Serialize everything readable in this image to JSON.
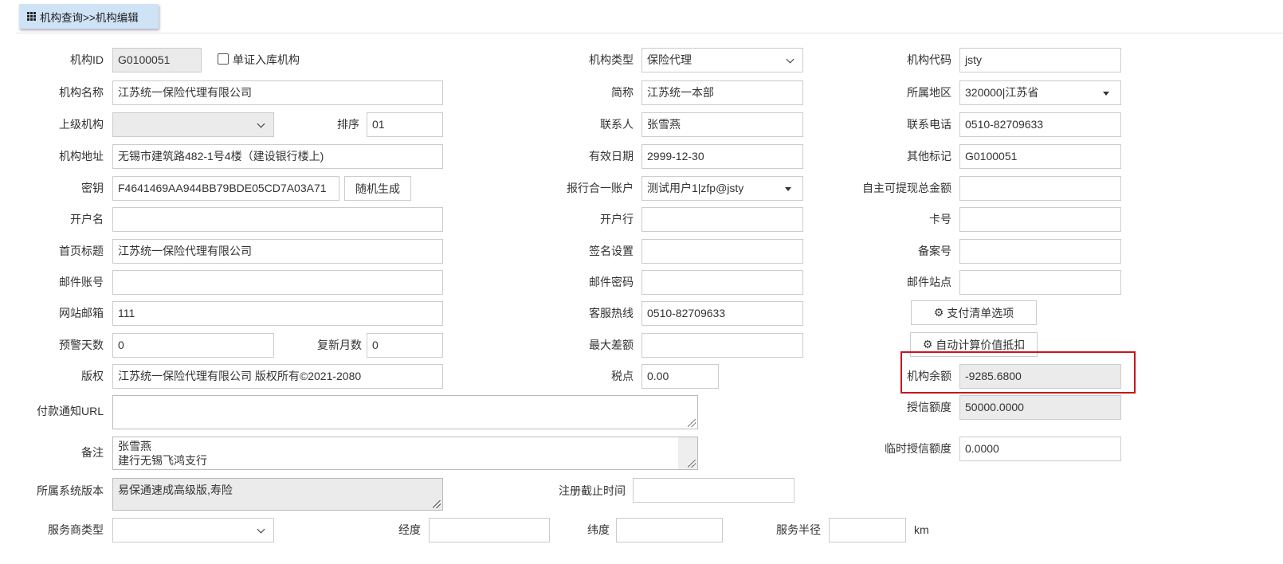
{
  "breadcrumb": "机构查询>>机构编辑",
  "col1": {
    "id_label": "机构ID",
    "id_value": "G0100051",
    "single_check_label": "单证入库机构",
    "name_label": "机构名称",
    "name_value": "江苏统一保险代理有限公司",
    "parent_label": "上级机构",
    "parent_value": "",
    "order_label": "排序",
    "order_value": "01",
    "address_label": "机构地址",
    "address_value": "无锡市建筑路482-1号4楼（建设银行楼上)",
    "key_label": "密钥",
    "key_value": "F4641469AA944BB79BDE05CD7A03A71",
    "random_button": "随机生成",
    "account_name_label": "开户名",
    "account_name_value": "",
    "home_title_label": "首页标题",
    "home_title_value": "江苏统一保险代理有限公司",
    "mail_account_label": "邮件账号",
    "mail_account_value": "",
    "site_mail_label": "网站邮箱",
    "site_mail_value": "111",
    "warn_days_label": "预警天数",
    "warn_days_value": "0",
    "renew_months_label": "复新月数",
    "renew_months_value": "0",
    "copyright_label": "版权",
    "copyright_value": "江苏统一保险代理有限公司 版权所有©2021-2080",
    "pay_url_label": "付款通知URL",
    "pay_url_value": "",
    "remark_label": "备注",
    "remark_line1": "张雪燕",
    "remark_line2": "建行无锡飞鸿支行",
    "sys_version_label": "所属系统版本",
    "sys_version_value": "易保通速成高级版,寿险",
    "reg_deadline_label": "注册截止时间",
    "reg_deadline_value": "",
    "provider_type_label": "服务商类型",
    "provider_type_value": "",
    "longitude_label": "经度",
    "longitude_value": "",
    "latitude_label": "纬度",
    "latitude_value": "",
    "radius_label": "服务半径",
    "radius_value": "",
    "radius_unit": "km"
  },
  "col2": {
    "type_label": "机构类型",
    "type_value": "保险代理",
    "short_label": "简称",
    "short_value": "江苏统一本部",
    "contact_label": "联系人",
    "contact_value": "张雪燕",
    "valid_label": "有效日期",
    "valid_value": "2999-12-30",
    "report_account_label": "报行合一账户",
    "report_account_value": "测试用户1|zfp@jsty",
    "bank_label": "开户行",
    "bank_value": "",
    "sign_label": "签名设置",
    "sign_value": "",
    "mail_pwd_label": "邮件密码",
    "mail_pwd_value": "",
    "hotline_label": "客服热线",
    "hotline_value": "0510-82709633",
    "max_diff_label": "最大差额",
    "max_diff_value": "",
    "tax_label": "税点",
    "tax_value": "0.00"
  },
  "col3": {
    "code_label": "机构代码",
    "code_value": "jsty",
    "region_label": "所属地区",
    "region_value": "320000|江苏省",
    "phone_label": "联系电话",
    "phone_value": "0510-82709633",
    "other_label": "其他标记",
    "other_value": "G0100051",
    "withdraw_label": "自主可提现总金额",
    "withdraw_value": "",
    "card_label": "卡号",
    "card_value": "",
    "record_label": "备案号",
    "record_value": "",
    "mail_site_label": "邮件站点",
    "mail_site_value": "",
    "pay_list_button": "支付清单选项",
    "auto_calc_button": "自动计算价值抵扣",
    "balance_label": "机构余额",
    "balance_value": "-9285.6800",
    "credit_label": "授信额度",
    "credit_value": "50000.0000",
    "temp_credit_label": "临时授信额度",
    "temp_credit_value": "0.0000"
  }
}
